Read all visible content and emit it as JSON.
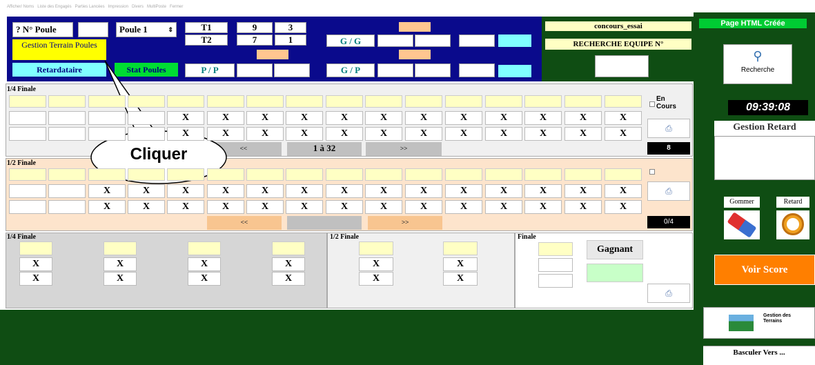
{
  "menu": {
    "items": [
      "Afficher/ Noms",
      "Liste des Engagés",
      "Parties Lancées",
      "Impression",
      "Divers",
      "MultiPoste",
      "Fermer"
    ]
  },
  "header": {
    "poule_label": "? N° Poule",
    "poule_select": "Poule 1",
    "t1": "T1",
    "t2": "T2",
    "t1_a": "9",
    "t1_b": "3",
    "t2_a": "7",
    "t2_b": "1",
    "gg": "G / G",
    "pp": "P / P",
    "gp": "G / P",
    "gestion_terrain": "Gestion Terrain Poules",
    "retardataire": "Retardataire",
    "stat_poules": "Stat Poules"
  },
  "concours": {
    "name": "concours_essai",
    "recherche_equipe": "RECHERCHE EQUIPE N°"
  },
  "right": {
    "page_html": "Page HTML Créée",
    "recherche": "Recherche",
    "clock": "09:39:08",
    "gestion_retard": "Gestion Retard",
    "gommer": "Gommer",
    "retard": "Retard",
    "voir_score": "Voir Score",
    "gestion_terrains": "Gestion des Terrains",
    "basculer": "Basculer Vers ..."
  },
  "section1": {
    "title": "1/4 Finale",
    "en_cours": "En Cours",
    "nav_prev": "<<",
    "nav_range": "1 à 32",
    "nav_next": ">>",
    "count": "8",
    "x": "X"
  },
  "section2": {
    "title": "1/2 Finale",
    "nav_prev": "<<",
    "nav_next": ">>",
    "count": "0/4"
  },
  "bottom": {
    "quarter": "1/4 Finale",
    "semi": "1/2 Finale",
    "final": "Finale",
    "gagnant": "Gagnant"
  },
  "callout": {
    "text": "Cliquer"
  },
  "colors": {
    "navy": "#0a0a8c",
    "dark_green": "#0f4d13",
    "yellow": "#ffff00",
    "cyan": "#80ffff",
    "peach": "#ffc690",
    "orange": "#ff7f00"
  }
}
